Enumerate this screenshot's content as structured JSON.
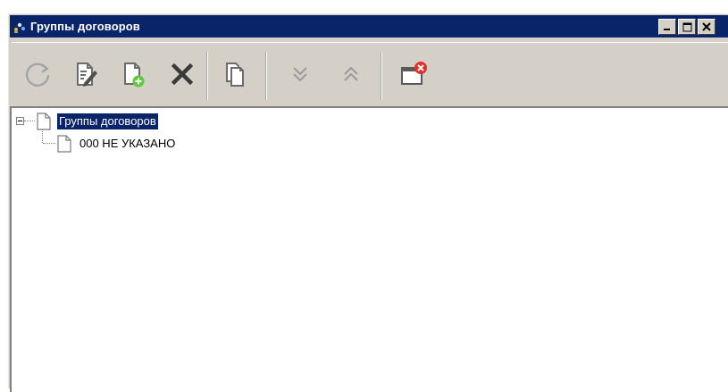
{
  "window": {
    "title": "Группы договоров",
    "controls": {
      "minimize_icon": "minimize-icon",
      "maximize_icon": "maximize-icon",
      "close_icon": "close-icon"
    }
  },
  "toolbar": {
    "buttons": [
      {
        "name": "refresh",
        "icon": "refresh-icon"
      },
      {
        "name": "edit",
        "icon": "edit-document-icon"
      },
      {
        "name": "add",
        "icon": "add-document-icon"
      },
      {
        "name": "delete",
        "icon": "delete-x-icon"
      },
      {
        "name": "copy",
        "icon": "copy-document-icon"
      },
      {
        "name": "expand-all",
        "icon": "double-chevron-down-icon"
      },
      {
        "name": "collapse-all",
        "icon": "double-chevron-up-icon"
      },
      {
        "name": "close-window",
        "icon": "close-window-icon"
      }
    ]
  },
  "tree": {
    "root": {
      "label": "Группы договоров",
      "expanded": true,
      "selected": true,
      "children": [
        {
          "label": "000 НЕ УКАЗАНО"
        }
      ]
    }
  },
  "colors": {
    "titlebar": "#0a246a",
    "face": "#d4d0c8",
    "selection": "#0a246a",
    "accent_green": "#5ec93a",
    "accent_red": "#e0302a"
  }
}
